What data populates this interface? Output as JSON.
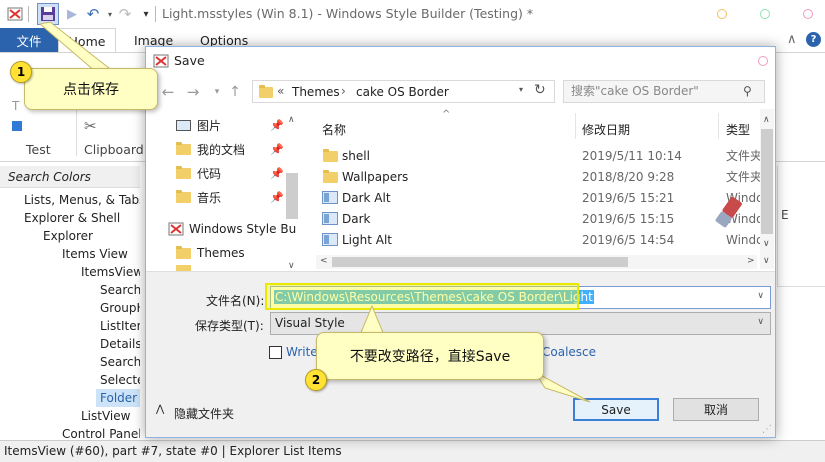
{
  "app": {
    "title": "Light.msstyles (Win 8.1) - Windows Style Builder (Testing) *",
    "tabs": {
      "file": "文件",
      "home": "Home",
      "image": "Image",
      "options": "Options"
    },
    "ribbon_labels": {
      "test": "Test",
      "clipboard": "Clipboard"
    },
    "search_colors": "Search Colors",
    "tree": [
      "Lists, Menus, & Tabs",
      "Explorer & Shell",
      "Explorer",
      "Items View",
      "ItemsView",
      "SearchC",
      "GroupH",
      "ListItem",
      "Details",
      "Search",
      "Selecte",
      "Folder",
      "ListView",
      "Control Panel"
    ],
    "status": "ItemsView (#60),  part #7,  state #0  |  Explorer List Items",
    "window_dots": [
      "#f0c060",
      "#8ee3b0",
      "#f09ac0"
    ],
    "accent": "#2b63ad"
  },
  "dialog": {
    "title": "Save",
    "breadcrumb": {
      "sep": "«",
      "part1": "Themes",
      "arrow": "›",
      "part2": "cake OS Border"
    },
    "search_placeholder": "搜索\"cake OS Border\"",
    "nav_items": [
      {
        "label": "图片",
        "icon": "pictures-icon",
        "pinned": true
      },
      {
        "label": "我的文档",
        "icon": "folder-icon",
        "pinned": true
      },
      {
        "label": "代码",
        "icon": "folder-icon",
        "pinned": true
      },
      {
        "label": "音乐",
        "icon": "folder-icon",
        "pinned": true
      },
      {
        "label": "Windows Style Bu",
        "icon": "app-icon",
        "pinned": false
      },
      {
        "label": "Themes",
        "icon": "folder-icon",
        "pinned": false
      }
    ],
    "columns": {
      "name": "名称",
      "date": "修改日期",
      "type": "类型"
    },
    "files": [
      {
        "name": "shell",
        "date": "2019/5/11 10:14",
        "type": "文件夹",
        "icon": "folder"
      },
      {
        "name": "Wallpapers",
        "date": "2018/8/20 9:28",
        "type": "文件夹",
        "icon": "folder"
      },
      {
        "name": "Dark Alt",
        "date": "2019/6/5 15:21",
        "type": "Windo",
        "icon": "theme"
      },
      {
        "name": "Dark",
        "date": "2019/6/5 15:15",
        "type": "Windo",
        "icon": "theme"
      },
      {
        "name": "Light Alt",
        "date": "2019/6/5 14:54",
        "type": "Windo",
        "icon": "theme"
      }
    ],
    "filename_label": "文件名(N):",
    "filename_value": "C:\\Windows\\Resources\\Themes\\cake OS Border\\Light",
    "filetype_label": "保存类型(T):",
    "filetype_value": "Visual Style",
    "write_label": "Write",
    "coalesce_label": "Coalesce",
    "hide_folders": "隐藏文件夹",
    "save_button": "Save",
    "cancel_button": "取消"
  },
  "callouts": {
    "one": {
      "number": "1",
      "text": "点击保存"
    },
    "two": {
      "number": "2",
      "text": "不要改变路径，直接Save"
    }
  }
}
